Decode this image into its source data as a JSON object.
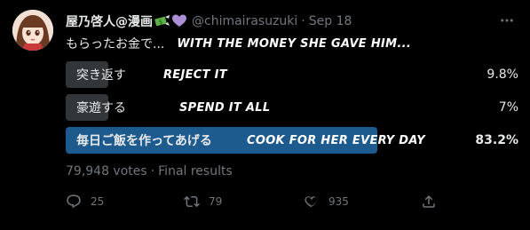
{
  "tweet": {
    "display_name": "屋乃啓人@漫画",
    "handle": "@chimairasuzuki",
    "separator": "·",
    "date": "Sep 18",
    "text": "もらったお金で...",
    "overlay_caption": "WITH THE MONEY SHE GAVE HIM..."
  },
  "poll": {
    "options": [
      {
        "label": "突き返す",
        "overlay": "REJECT IT",
        "percent_text": "9.8%",
        "percent": 9.8,
        "winner": false
      },
      {
        "label": "豪遊する",
        "overlay": "SPEND IT ALL",
        "percent_text": "7%",
        "percent": 7,
        "winner": false
      },
      {
        "label": "毎日ご飯を作ってあげる",
        "overlay": "COOK FOR HER EVERY DAY",
        "percent_text": "83.2%",
        "percent": 83.2,
        "winner": true
      }
    ],
    "votes": "79,948 votes",
    "separator": "·",
    "status": "Final results"
  },
  "actions": {
    "replies": "25",
    "reposts": "79",
    "likes": "935"
  },
  "colors": {
    "background": "#000000",
    "text": "#e7e9ea",
    "muted": "#71767b",
    "poll_bar": "#333639",
    "poll_winner": "#1d5a8e"
  },
  "icons": {
    "more": "more-icon",
    "reply": "reply-icon",
    "repost": "repost-icon",
    "like": "heart-icon",
    "share": "share-icon",
    "emoji1": "money-with-wings-emoji",
    "emoji2": "purple-heart-emoji"
  }
}
